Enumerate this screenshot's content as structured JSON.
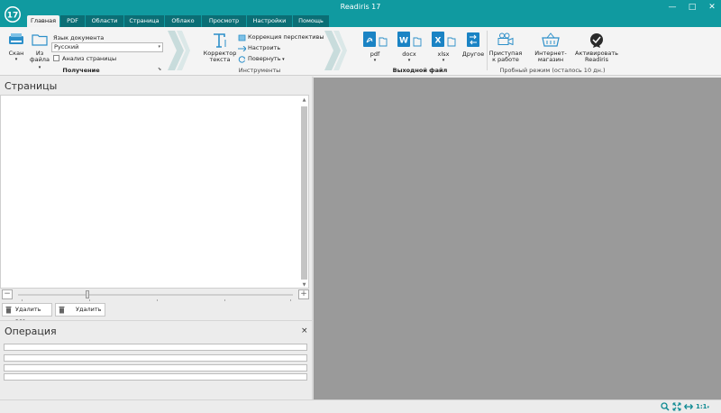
{
  "window": {
    "title": "Readiris 17",
    "app_badge": "17"
  },
  "tabs": [
    "Главная",
    "PDF",
    "Области",
    "Страница",
    "Облако",
    "Просмотр",
    "Настройки",
    "Помощь"
  ],
  "ribbon": {
    "acquire": {
      "scan_label": "Скан",
      "from_file_label_1": "Из",
      "from_file_label_2": "файла",
      "doc_language_label": "Язык документа",
      "doc_language_value": "Русский",
      "page_analysis_label": "Анализ страницы",
      "group_label": "Получение"
    },
    "tools": {
      "corrector_label_1": "Корректор",
      "corrector_label_2": "текста",
      "perspective_label": "Коррекция перспективы",
      "adjust_label": "Настроить",
      "rotate_label": "Повернуть",
      "group_label": "Инструменты"
    },
    "output": {
      "pdf_label": "pdf",
      "docx_label": "docx",
      "xlsx_label": "xlsx",
      "other_label": "Другое",
      "group_label": "Выходной файл"
    },
    "trial": {
      "get_started_label_1": "Приступая",
      "get_started_label_2": "к работе",
      "shop_label": "Интернет-магазин",
      "activate_label_1": "Активировать",
      "activate_label_2": "Readiris",
      "group_label": "Пробный режим (осталось 10 дн.)"
    }
  },
  "pages_panel": {
    "title": "Страницы",
    "delete_all_label": "Удалить все",
    "delete_label": "Удалить"
  },
  "operation_panel": {
    "title": "Операция",
    "close_glyph": "×"
  },
  "statusbar": {
    "zoom_ratio": "1:1"
  },
  "colors": {
    "accent": "#109aa0",
    "accent_dark": "#0b6e75",
    "viewer_bg": "#9a9a9a"
  }
}
